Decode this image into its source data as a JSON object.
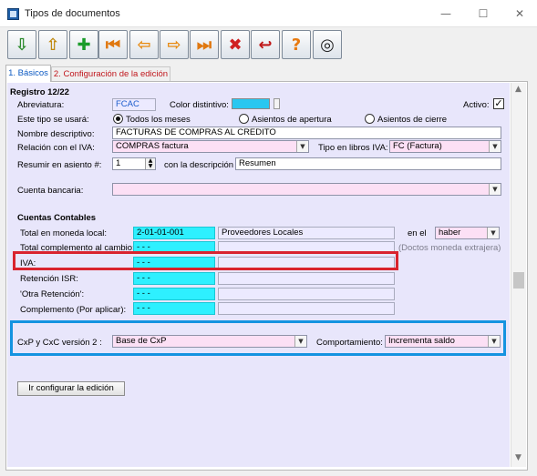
{
  "window": {
    "title": "Tipos de documentos",
    "minimize": "—",
    "maximize": "☐",
    "close": "✕"
  },
  "toolbar": [
    {
      "name": "save-icon",
      "glyph": "⇩",
      "color": "#2c8a2c"
    },
    {
      "name": "open-icon",
      "glyph": "⇧",
      "color": "#c08a10"
    },
    {
      "name": "new-icon",
      "glyph": "✚",
      "color": "#1a9c2a"
    },
    {
      "name": "first-icon",
      "glyph": "⏮",
      "color": "#e07810"
    },
    {
      "name": "previous-icon",
      "glyph": "⇦",
      "color": "#e88a10"
    },
    {
      "name": "next-icon",
      "glyph": "⇨",
      "color": "#e88a10"
    },
    {
      "name": "last-icon",
      "glyph": "⏭",
      "color": "#e07810"
    },
    {
      "name": "delete-icon",
      "glyph": "✖",
      "color": "#d02020"
    },
    {
      "name": "exit-icon",
      "glyph": "↩",
      "color": "#c01818"
    },
    {
      "name": "help-icon",
      "glyph": "?",
      "color": "#e87a10"
    },
    {
      "name": "binoculars-icon",
      "glyph": "◎",
      "color": "#202020"
    }
  ],
  "tabs": {
    "basicos": "1. Básicos",
    "config": "2. Configuración de la edición"
  },
  "form": {
    "registro": "Registro 12/22",
    "abreviatura_label": "Abreviatura:",
    "abreviatura_value": "FCAC",
    "color_label": "Color distintivo:",
    "color_value": "#29c7f0",
    "activo_label": "Activo:",
    "activo_check": "✓",
    "uso_label": "Este tipo se usará:",
    "radio_todos": "Todos los meses",
    "radio_apertura": "Asientos de apertura",
    "radio_cierre": "Asientos de cierre",
    "nombre_label": "Nombre descriptivo:",
    "nombre_value": "FACTURAS DE COMPRAS AL CREDITO",
    "relacion_label": "Relación con el IVA:",
    "relacion_value": "COMPRAS factura",
    "tipo_libros_label": "Tipo en libros IVA:",
    "tipo_libros_value": "FC (Factura)",
    "resumir_label": "Resumir en asiento #:",
    "resumir_value": "1",
    "descripcion_label": "con la descripción",
    "descripcion_value": "Resumen",
    "cuenta_bancaria_label": "Cuenta bancaria:",
    "cuentas_title": "Cuentas Contables",
    "total_local_label": "Total en moneda local:",
    "total_local_code": "2-01-01-001",
    "total_local_name": "Proveedores Locales",
    "en_el_label": "en el",
    "en_el_value": "haber",
    "total_complemento_label": "Total complemento al cambio:",
    "total_complemento_code": "- - -",
    "doctos_note": "(Doctos moneda extrajera)",
    "iva_label": "IVA:",
    "iva_code": "- - -",
    "retencion_isr_label": "Retención ISR:",
    "retencion_isr_code": "- - -",
    "otra_retencion_label": "'Otra Retención':",
    "otra_retencion_code": "- - -",
    "complemento_label": "Complemento (Por aplicar):",
    "complemento_code": "- - -",
    "cxp_label": "CxP y CxC versión 2 :",
    "cxp_value": "Base de CxP",
    "comportamiento_label": "Comportamiento:",
    "comportamiento_value": "Incrementa saldo",
    "configurar_button": "Ir configurar la edición"
  }
}
